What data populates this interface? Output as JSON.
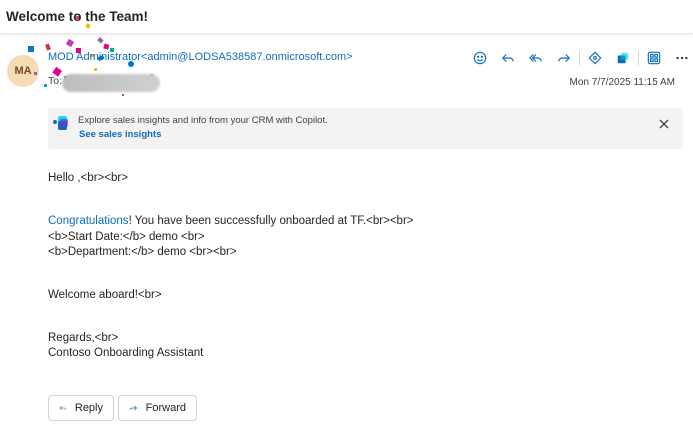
{
  "email": {
    "subject": "Welcome to the Team!",
    "avatar_initials": "MA",
    "sender": "MOD Administrator<admin@LODSA538587.onmicrosoft.com>",
    "to_label": "To:",
    "to_partial": "S",
    "date": "Mon 7/7/2025 11:15 AM"
  },
  "copilot_banner": {
    "text": "Explore sales insights and info from your CRM with Copilot.",
    "link": "See sales insights"
  },
  "body": {
    "greeting": "Hello ,<br><br>",
    "congrats_link": "Congratulations",
    "congrats_rest": "! You have been successfully onboarded at TF.<br><br>",
    "start_date_line": "<b>Start Date:</b> demo <br>",
    "department_line": "<b>Department:</b> demo <br><br>",
    "welcome": "Welcome aboard!<br>",
    "regards": "Regards,<br>",
    "signature": "Contoso Onboarding Assistant"
  },
  "actions": {
    "reply": "Reply",
    "forward": "Forward"
  },
  "toolbar_icons": [
    "emoji-icon",
    "reply-icon",
    "reply-all-icon",
    "forward-icon",
    "apps-icon",
    "dynamics-icon",
    "grid-icon",
    "more-icon"
  ],
  "colors": {
    "link_blue": "#0f6cbd",
    "avatar_bg": "#f5dcb4",
    "banner_bg": "#f3f3f3"
  }
}
